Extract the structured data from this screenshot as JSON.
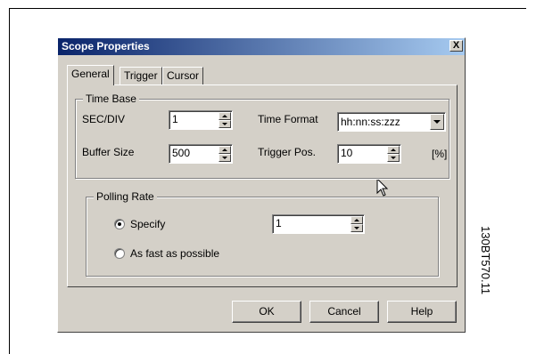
{
  "dialog": {
    "title": "Scope Properties",
    "close_label": "X"
  },
  "tabs": [
    {
      "label": "General",
      "active": true
    },
    {
      "label": "Trigger",
      "active": false
    },
    {
      "label": "Cursor",
      "active": false
    }
  ],
  "time_base": {
    "group_label": "Time Base",
    "sec_div_label": "SEC/DIV",
    "sec_div_value": "1",
    "time_format_label": "Time Format",
    "time_format_value": "hh:nn:ss:zzz",
    "buffer_size_label": "Buffer Size",
    "buffer_size_value": "500",
    "trigger_pos_label": "Trigger Pos.",
    "trigger_pos_value": "10",
    "trigger_pos_unit": "[%]"
  },
  "polling_rate": {
    "group_label": "Polling Rate",
    "specify_label": "Specify",
    "specify_value": "1",
    "fast_label": "As fast as possible",
    "selected": "specify"
  },
  "buttons": {
    "ok": "OK",
    "cancel": "Cancel",
    "help": "Help"
  },
  "side_code": "130BT570.11",
  "colors": {
    "face": "#d4d0c8",
    "titlebar_start": "#0a246a",
    "titlebar_end": "#a6caf0"
  }
}
